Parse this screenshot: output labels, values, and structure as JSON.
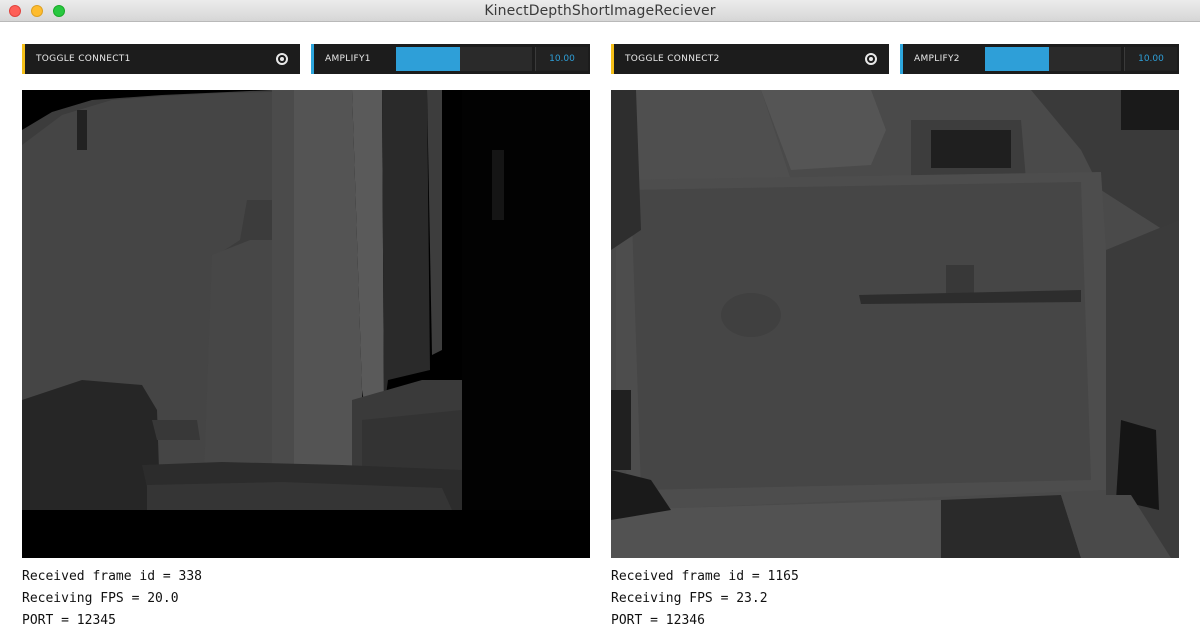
{
  "window": {
    "title": "KinectDepthShortImageReciever"
  },
  "panels": [
    {
      "toggle_label": "TOGGLE CONNECT1",
      "amplify_label": "AMPLIFY1",
      "amplify_value": "10.00",
      "amplify_fill_fraction": 0.47,
      "frame_line": "Received frame id = 338",
      "fps_line": "Receiving FPS = 20.0",
      "port_line": "PORT = 12345"
    },
    {
      "toggle_label": "TOGGLE CONNECT2",
      "amplify_label": "AMPLIFY2",
      "amplify_value": "10.00",
      "amplify_fill_fraction": 0.47,
      "frame_line": "Received frame id = 1165",
      "fps_line": "Receiving FPS = 23.2",
      "port_line": "PORT = 12346"
    }
  ],
  "colors": {
    "toggle_accent": "#f5c019",
    "amplify_accent": "#2da6dd",
    "control_bg": "#1c1c1c"
  },
  "icons": {
    "window_close": "close-icon",
    "window_minimize": "minimize-icon",
    "window_maximize": "maximize-icon",
    "toggle_state": "radio-on-icon"
  }
}
